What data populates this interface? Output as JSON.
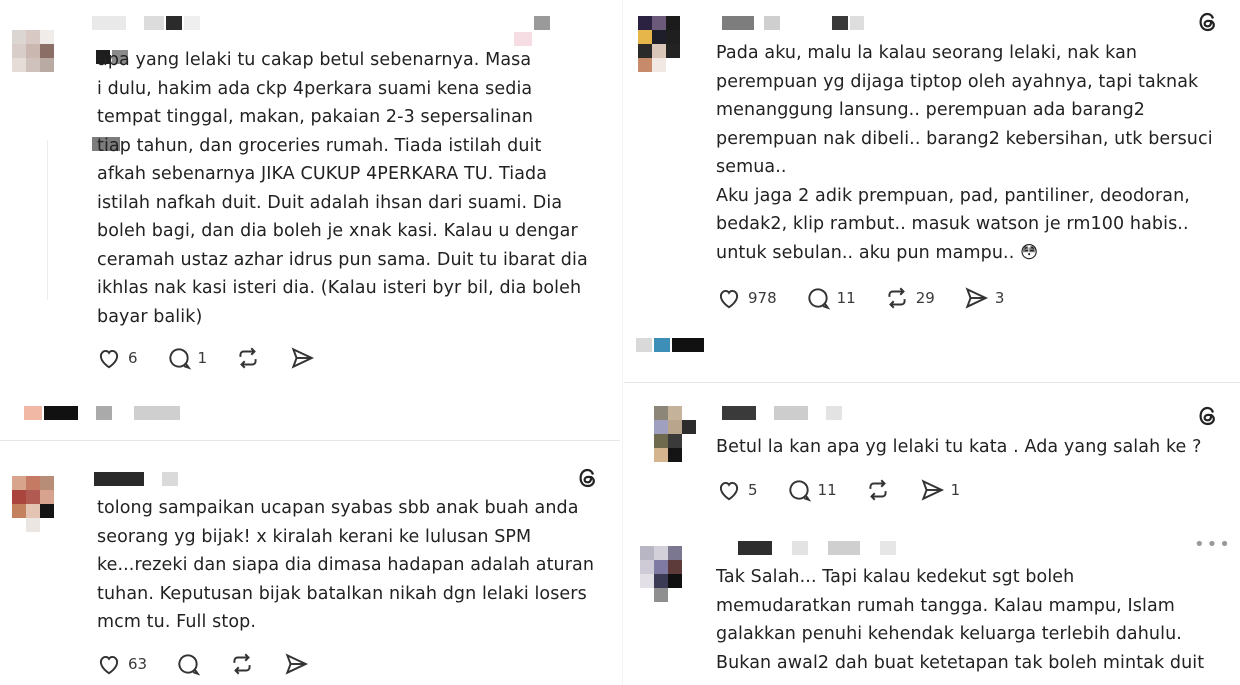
{
  "posts": {
    "p1": {
      "text": "apa yang lelaki tu cakap betul sebenarnya. Masa\n i dulu, hakim ada ckp 4perkara suami kena sedia\n tempat tinggal, makan, pakaian 2-3 sepersalinan\ntiap tahun, dan groceries rumah. Tiada istilah duit\nafkah sebenarnya JIKA CUKUP 4PERKARA TU. Tiada\nistilah nafkah duit. Duit adalah ihsan dari suami. Dia\nboleh bagi, dan dia boleh je xnak kasi. Kalau u dengar\nceramah ustaz azhar idrus pun sama. Duit tu ibarat dia\nikhlas nak kasi isteri dia. (Kalau isteri byr bil, dia boleh\nbayar balik)",
      "likes": "6",
      "replies": "1",
      "reposts": "",
      "shares": ""
    },
    "p2": {
      "text": "tolong sampaikan ucapan syabas sbb anak buah anda\nseorang yg bijak! x kiralah kerani ke lulusan SPM\nke...rezeki dan siapa dia dimasa hadapan adalah aturan\ntuhan. Keputusan bijak batalkan nikah dgn lelaki losers\nmcm tu. Full stop.",
      "likes": "63",
      "replies": "",
      "reposts": "",
      "shares": ""
    },
    "p3": {
      "text": "Pada aku, malu la kalau seorang lelaki, nak kan\nperempuan yg dijaga tiptop oleh ayahnya, tapi taknak\nmenanggung lansung.. perempuan ada barang2\nperempuan nak dibeli.. barang2 kebersihan, utk bersuci\nsemua..\nAku jaga 2 adik prempuan, pad, pantiliner, deodoran,\nbedak2, klip rambut.. masuk watson je rm100 habis..\nuntuk sebulan.. aku pun mampu.. 😳",
      "likes": "978",
      "replies": "11",
      "reposts": "29",
      "shares": "3"
    },
    "p4": {
      "text": "Betul la kan apa yg lelaki tu kata . Ada yang salah ke ?",
      "likes": "5",
      "replies": "11",
      "reposts": "",
      "shares": "1"
    },
    "p5": {
      "text": "Tak Salah... Tapi kalau kedekut sgt boleh\nmemudaratkan rumah tangga.  Kalau mampu, Islam\ngalakkan penuhi kehendak keluarga terlebih dahulu.\nBukan awal2 dah buat ketetapan tak boleh mintak duit"
    },
    "more_label": "•••"
  },
  "icons": {
    "like": "heart-icon",
    "reply": "comment-icon",
    "repost": "repost-icon",
    "share": "share-icon",
    "brand": "threads-logo-icon",
    "more": "more-options-icon"
  },
  "colors": {
    "text": "#222222",
    "icon": "#3a3a3a",
    "divider": "#e6e6e6"
  }
}
